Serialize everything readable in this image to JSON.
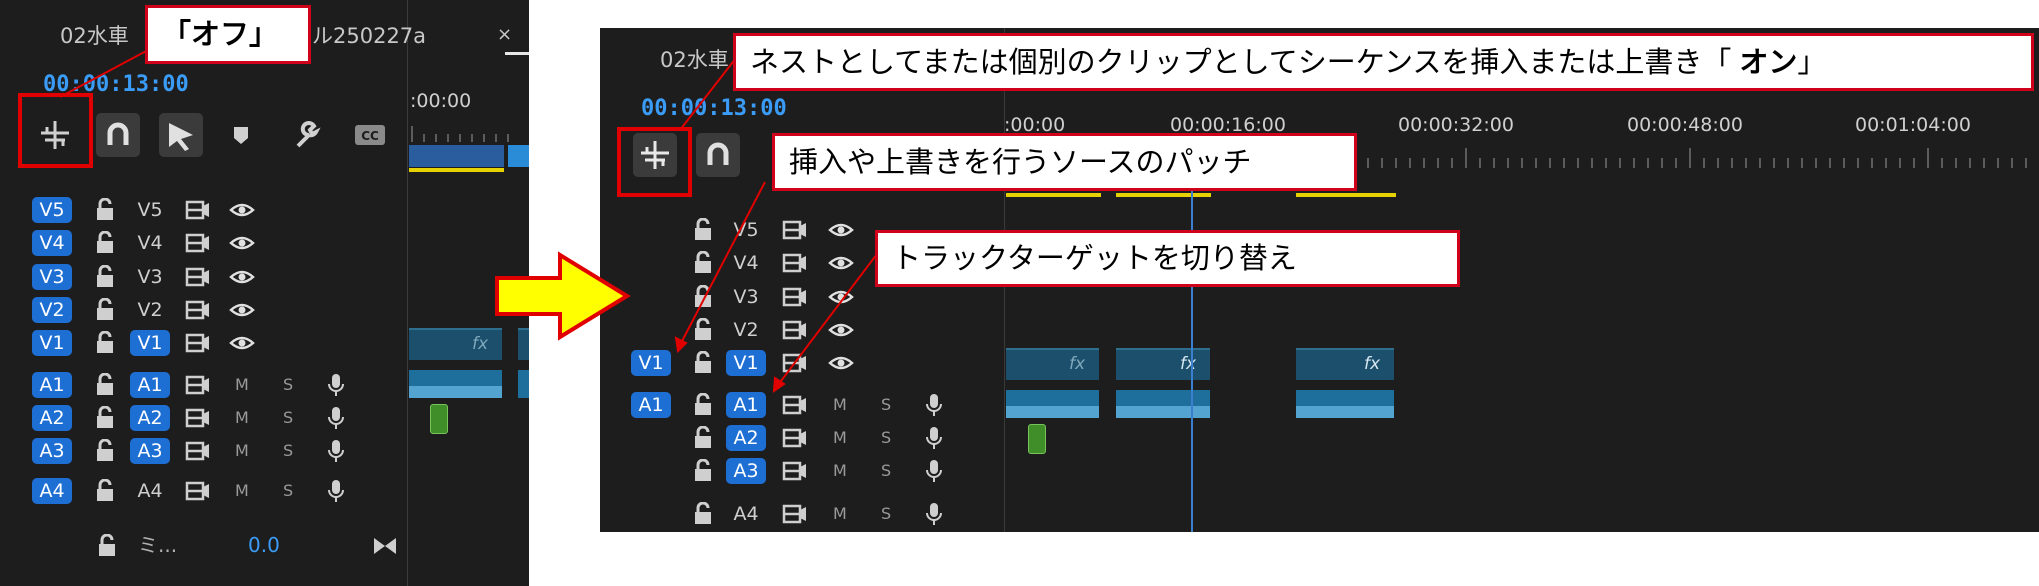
{
  "left_panel": {
    "tab_title": "02水車",
    "tab_title_suffix": "ル250227a",
    "tab_close": "×",
    "timecode": "00:00:13:00",
    "ruler_label": ":00:00",
    "tracks": [
      {
        "src": "V5",
        "tgt": "V5",
        "src_on": true,
        "tgt_on": false,
        "kind": "video"
      },
      {
        "src": "V4",
        "tgt": "V4",
        "src_on": true,
        "tgt_on": false,
        "kind": "video"
      },
      {
        "src": "V3",
        "tgt": "V3",
        "src_on": true,
        "tgt_on": false,
        "kind": "video"
      },
      {
        "src": "V2",
        "tgt": "V2",
        "src_on": true,
        "tgt_on": false,
        "kind": "video"
      },
      {
        "src": "V1",
        "tgt": "V1",
        "src_on": true,
        "tgt_on": true,
        "kind": "video"
      },
      {
        "src": "A1",
        "tgt": "A1",
        "src_on": true,
        "tgt_on": true,
        "kind": "audio"
      },
      {
        "src": "A2",
        "tgt": "A2",
        "src_on": true,
        "tgt_on": true,
        "kind": "audio"
      },
      {
        "src": "A3",
        "tgt": "A3",
        "src_on": true,
        "tgt_on": true,
        "kind": "audio"
      },
      {
        "src": "A4",
        "tgt": "A4",
        "src_on": true,
        "tgt_on": false,
        "kind": "audio"
      }
    ],
    "mix_label": "ミ...",
    "mix_value": "0.0",
    "m_label": "M",
    "s_label": "S",
    "fx_label": "fx"
  },
  "right_panel": {
    "tab_title": "02水車",
    "timecode": "00:00:13:00",
    "ruler_labels": [
      ":00:00",
      "00:00:16:00",
      "00:00:32:00",
      "00:00:48:00",
      "00:01:04:00"
    ],
    "tracks": [
      {
        "src": "",
        "tgt": "V5",
        "src_on": false,
        "tgt_on": false,
        "kind": "video"
      },
      {
        "src": "",
        "tgt": "V4",
        "src_on": false,
        "tgt_on": false,
        "kind": "video"
      },
      {
        "src": "",
        "tgt": "V3",
        "src_on": false,
        "tgt_on": false,
        "kind": "video"
      },
      {
        "src": "",
        "tgt": "V2",
        "src_on": false,
        "tgt_on": false,
        "kind": "video"
      },
      {
        "src": "V1",
        "tgt": "V1",
        "src_on": true,
        "tgt_on": true,
        "kind": "video"
      },
      {
        "src": "A1",
        "tgt": "A1",
        "src_on": true,
        "tgt_on": true,
        "kind": "audio"
      },
      {
        "src": "",
        "tgt": "A2",
        "src_on": false,
        "tgt_on": true,
        "kind": "audio"
      },
      {
        "src": "",
        "tgt": "A3",
        "src_on": false,
        "tgt_on": true,
        "kind": "audio"
      },
      {
        "src": "",
        "tgt": "A4",
        "src_on": false,
        "tgt_on": false,
        "kind": "audio"
      }
    ],
    "m_label": "M",
    "s_label": "S",
    "fx_label": "fx"
  },
  "annotations": {
    "off_label": "「オフ」",
    "nest_prefix": "ネストとしてまたは個別のクリップとしてシーケンスを挿入または上書き「",
    "nest_on": "オン",
    "nest_suffix": "」",
    "patch_label": "挿入や上書きを行うソースのパッチ",
    "target_label": "トラックターゲットを切り替え"
  },
  "colors": {
    "panel_bg": "#1d1d1d",
    "accent_blue": "#1e6fd3",
    "timecode_blue": "#3a9cf6",
    "callout_border": "#d0021b",
    "arrow_fill": "#ffff00",
    "arrow_stroke": "#e00000",
    "clip_video": "#1b4f6b",
    "clip_audio": "#1f6f9c",
    "playhead": "#3a7fd0",
    "work_area": "#e6d200"
  }
}
